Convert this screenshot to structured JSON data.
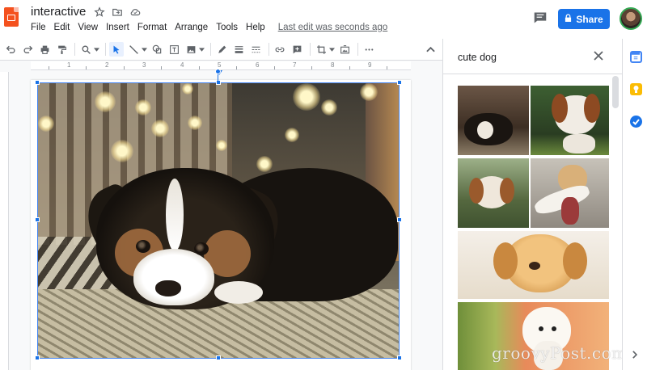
{
  "header": {
    "doc_title": "interactive",
    "share_label": "Share",
    "last_edit": "Last edit was seconds ago"
  },
  "menu": [
    "File",
    "Edit",
    "View",
    "Insert",
    "Format",
    "Arrange",
    "Tools",
    "Help"
  ],
  "ruler": {
    "numbers": [
      "1",
      "2",
      "3",
      "4",
      "5",
      "6",
      "7",
      "8",
      "9"
    ]
  },
  "image_search": {
    "query": "cute dog"
  },
  "watermark": "groovyPost.com",
  "colors": {
    "accent": "#1a73e8",
    "logo": "#f4511e",
    "selection": "#4285f4"
  },
  "icons": {
    "title_bar": [
      "star-icon",
      "move-folder-icon",
      "cloud-status-icon"
    ],
    "toolbar": [
      "undo-icon",
      "redo-icon",
      "print-icon",
      "paint-format-icon",
      "zoom-icon",
      "select-icon",
      "line-icon",
      "shape-icon",
      "text-box-icon",
      "image-icon",
      "pen-icon",
      "border-weight-icon",
      "border-dash-icon",
      "link-icon",
      "comment-add-icon",
      "crop-icon",
      "replace-image-icon",
      "more-icon",
      "collapse-icon"
    ],
    "rail": [
      "calendar-icon",
      "keep-icon",
      "tasks-icon",
      "expand-icon"
    ]
  }
}
